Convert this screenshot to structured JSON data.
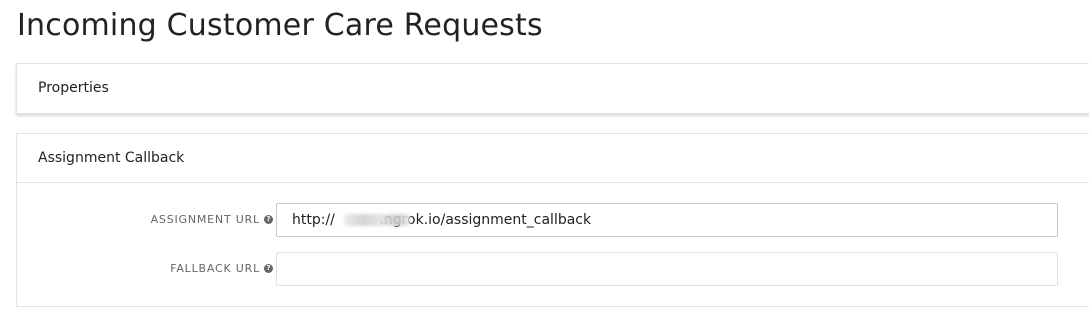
{
  "page": {
    "title": "Incoming Customer Care Requests"
  },
  "properties_panel": {
    "header": "Properties"
  },
  "callback_panel": {
    "header": "Assignment Callback",
    "fields": [
      {
        "label": "ASSIGNMENT URL",
        "help_icon": "question-circle-icon",
        "value": "http://          .ngrok.io/assignment_callback",
        "placeholder": ""
      },
      {
        "label": "FALLBACK URL",
        "help_icon": "question-circle-icon",
        "value": "",
        "placeholder": ""
      }
    ]
  },
  "icons": {
    "help_glyph": "?"
  }
}
